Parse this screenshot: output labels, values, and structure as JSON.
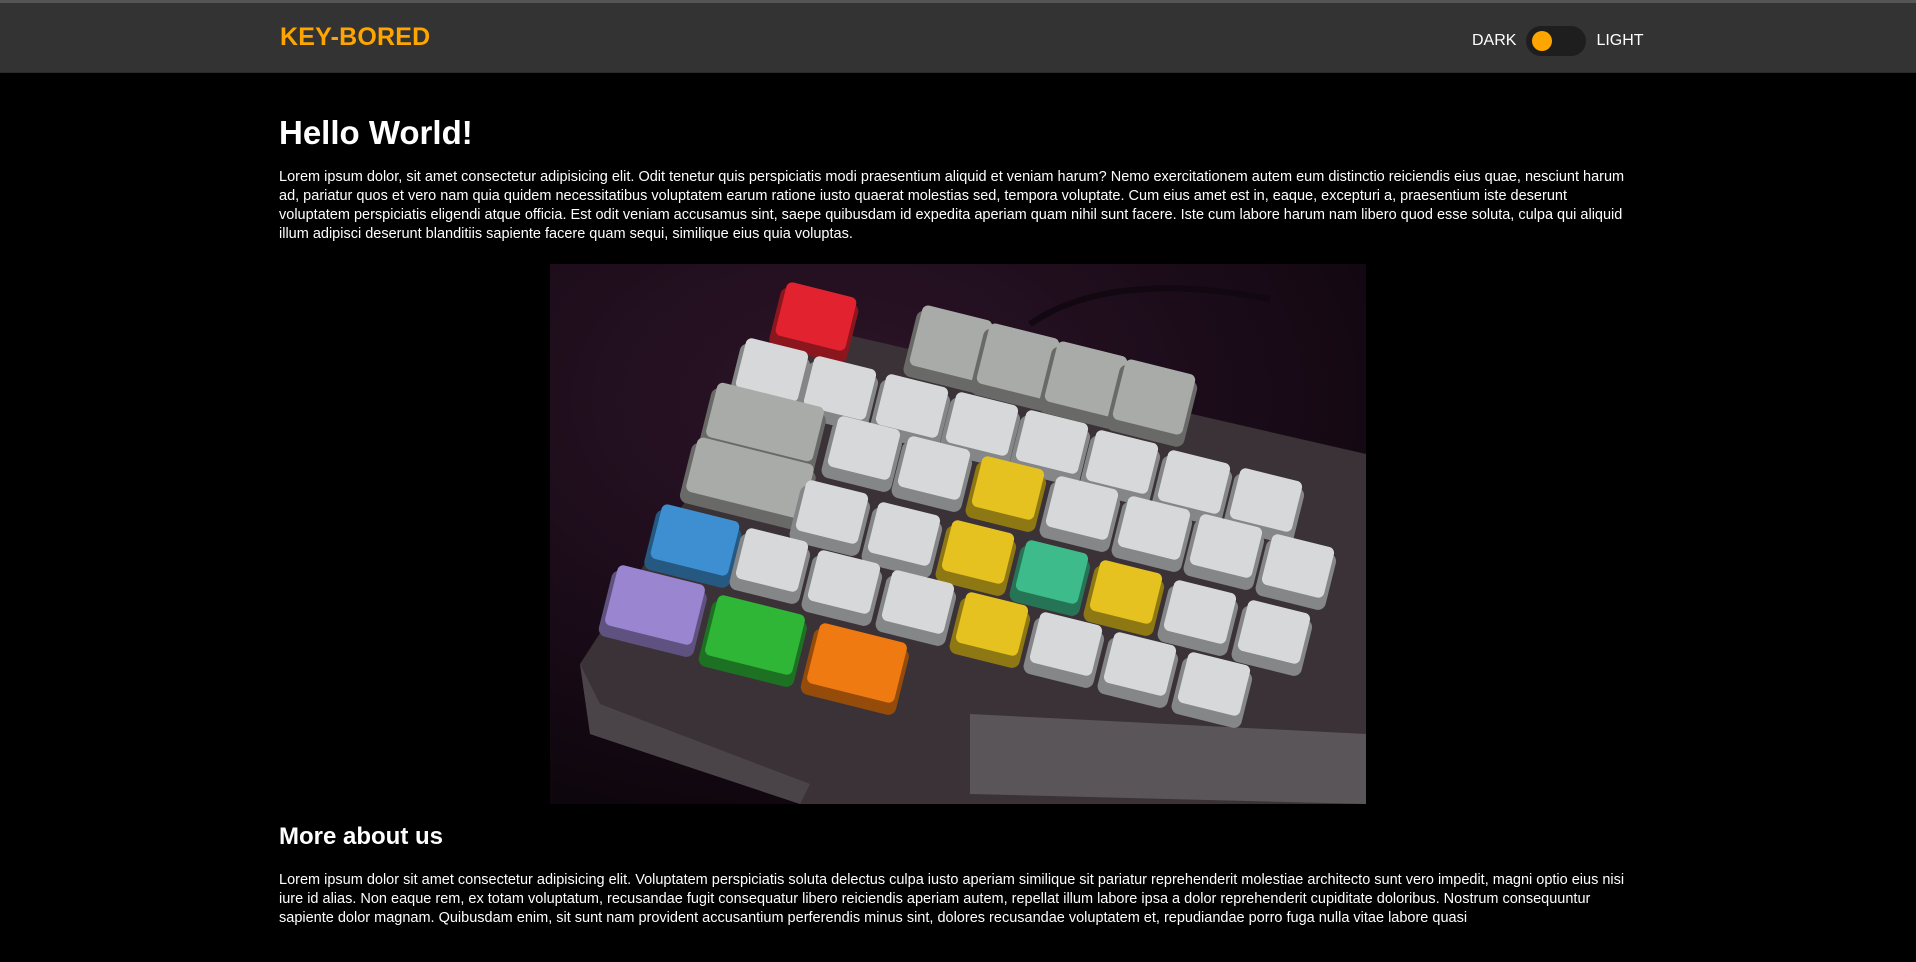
{
  "header": {
    "brand": "KEY-BORED",
    "theme_toggle": {
      "dark_label": "DARK",
      "light_label": "LIGHT",
      "state": "dark"
    }
  },
  "main": {
    "title": "Hello World!",
    "intro": "Lorem ipsum dolor, sit amet consectetur adipisicing elit. Odit tenetur quis perspiciatis modi praesentium aliquid et veniam harum? Nemo exercitationem autem eum distinctio reiciendis eius quae, nesciunt harum ad, pariatur quos et vero nam quia quidem necessitatibus voluptatem earum ratione iusto quaerat molestias sed, tempora voluptate. Cum eius amet est in, eaque, excepturi a, praesentium iste deserunt voluptatem perspiciatis eligendi atque officia. Est odit veniam accusamus sint, saepe quibusdam id expedita aperiam quam nihil sunt facere. Iste cum labore harum nam libero quod esse soluta, culpa qui aliquid illum adipisci deserunt blanditiis sapiente facere quam sequi, similique eius quia voluptas.",
    "hero_image_icon": "mechanical-keyboard-photo-icon",
    "about_title": "More about us",
    "about_text": "Lorem ipsum dolor sit amet consectetur adipisicing elit. Voluptatem perspiciatis soluta delectus culpa iusto aperiam similique sit pariatur reprehenderit molestiae architecto sunt vero impedit, magni optio eius nisi iure id alias. Non eaque rem, ex totam voluptatum, recusandae fugit consequatur libero reiciendis aperiam autem, repellat illum labore ipsa a dolor reprehenderit cupiditate doloribus. Nostrum consequuntur sapiente dolor magnam. Quibusdam enim, sit sunt nam provident accusantium perferendis minus sint, dolores recusandae voluptatem et, repudiandae porro fuga nulla vitae labore quasi"
  },
  "colors": {
    "accent": "#ffa500",
    "navbar": "#333333",
    "background": "#000000",
    "text": "#ffffff"
  }
}
